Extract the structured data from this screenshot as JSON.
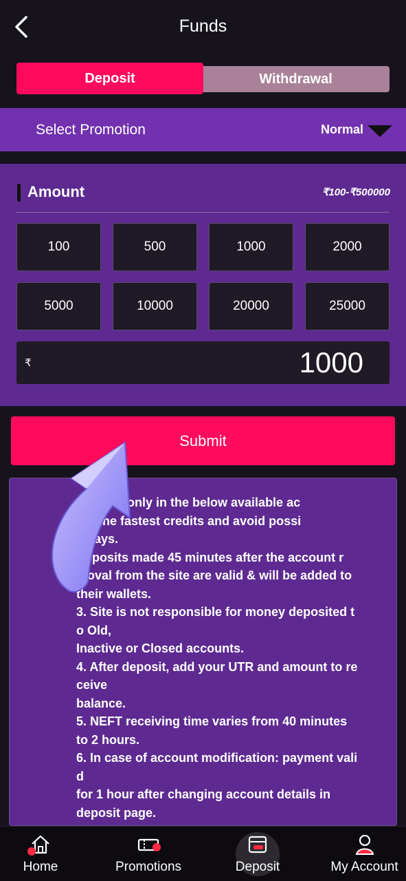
{
  "header": {
    "title": "Funds"
  },
  "tabs": {
    "deposit": "Deposit",
    "withdrawal": "Withdrawal"
  },
  "promotion": {
    "label": "Select Promotion",
    "selected": "Normal"
  },
  "amount": {
    "title": "Amount",
    "range": "₹100-₹500000",
    "chips": [
      "100",
      "500",
      "1000",
      "2000",
      "5000",
      "10000",
      "20000",
      "25000"
    ],
    "currency_symbol": "₹",
    "value": "1000"
  },
  "submit_label": "Submit",
  "info": {
    "lines": [
      "t money only in the below available ac",
      "get the fastest credits and avoid possi",
      "delays.",
      "Deposits made 45 minutes after the account r",
      "moval from the site are valid & will be added to",
      "their wallets.",
      "3. Site is not responsible for money deposited t",
      "o Old,",
      "Inactive or Closed accounts.",
      "4. After deposit, add your UTR and amount to re",
      "ceive",
      "balance.",
      "5. NEFT receiving time varies from 40 minutes",
      "to 2 hours.",
      "6. In case of account modification: payment vali",
      "d",
      "for 1 hour after changing account details in",
      "deposit page."
    ]
  },
  "nav": {
    "home": "Home",
    "promotions": "Promotions",
    "deposit": "Deposit",
    "account": "My Account"
  },
  "colors": {
    "accent": "#ff0a5d",
    "purple": "#5e2a91",
    "promo_purple": "#7231ae",
    "dark": "#17131d"
  }
}
